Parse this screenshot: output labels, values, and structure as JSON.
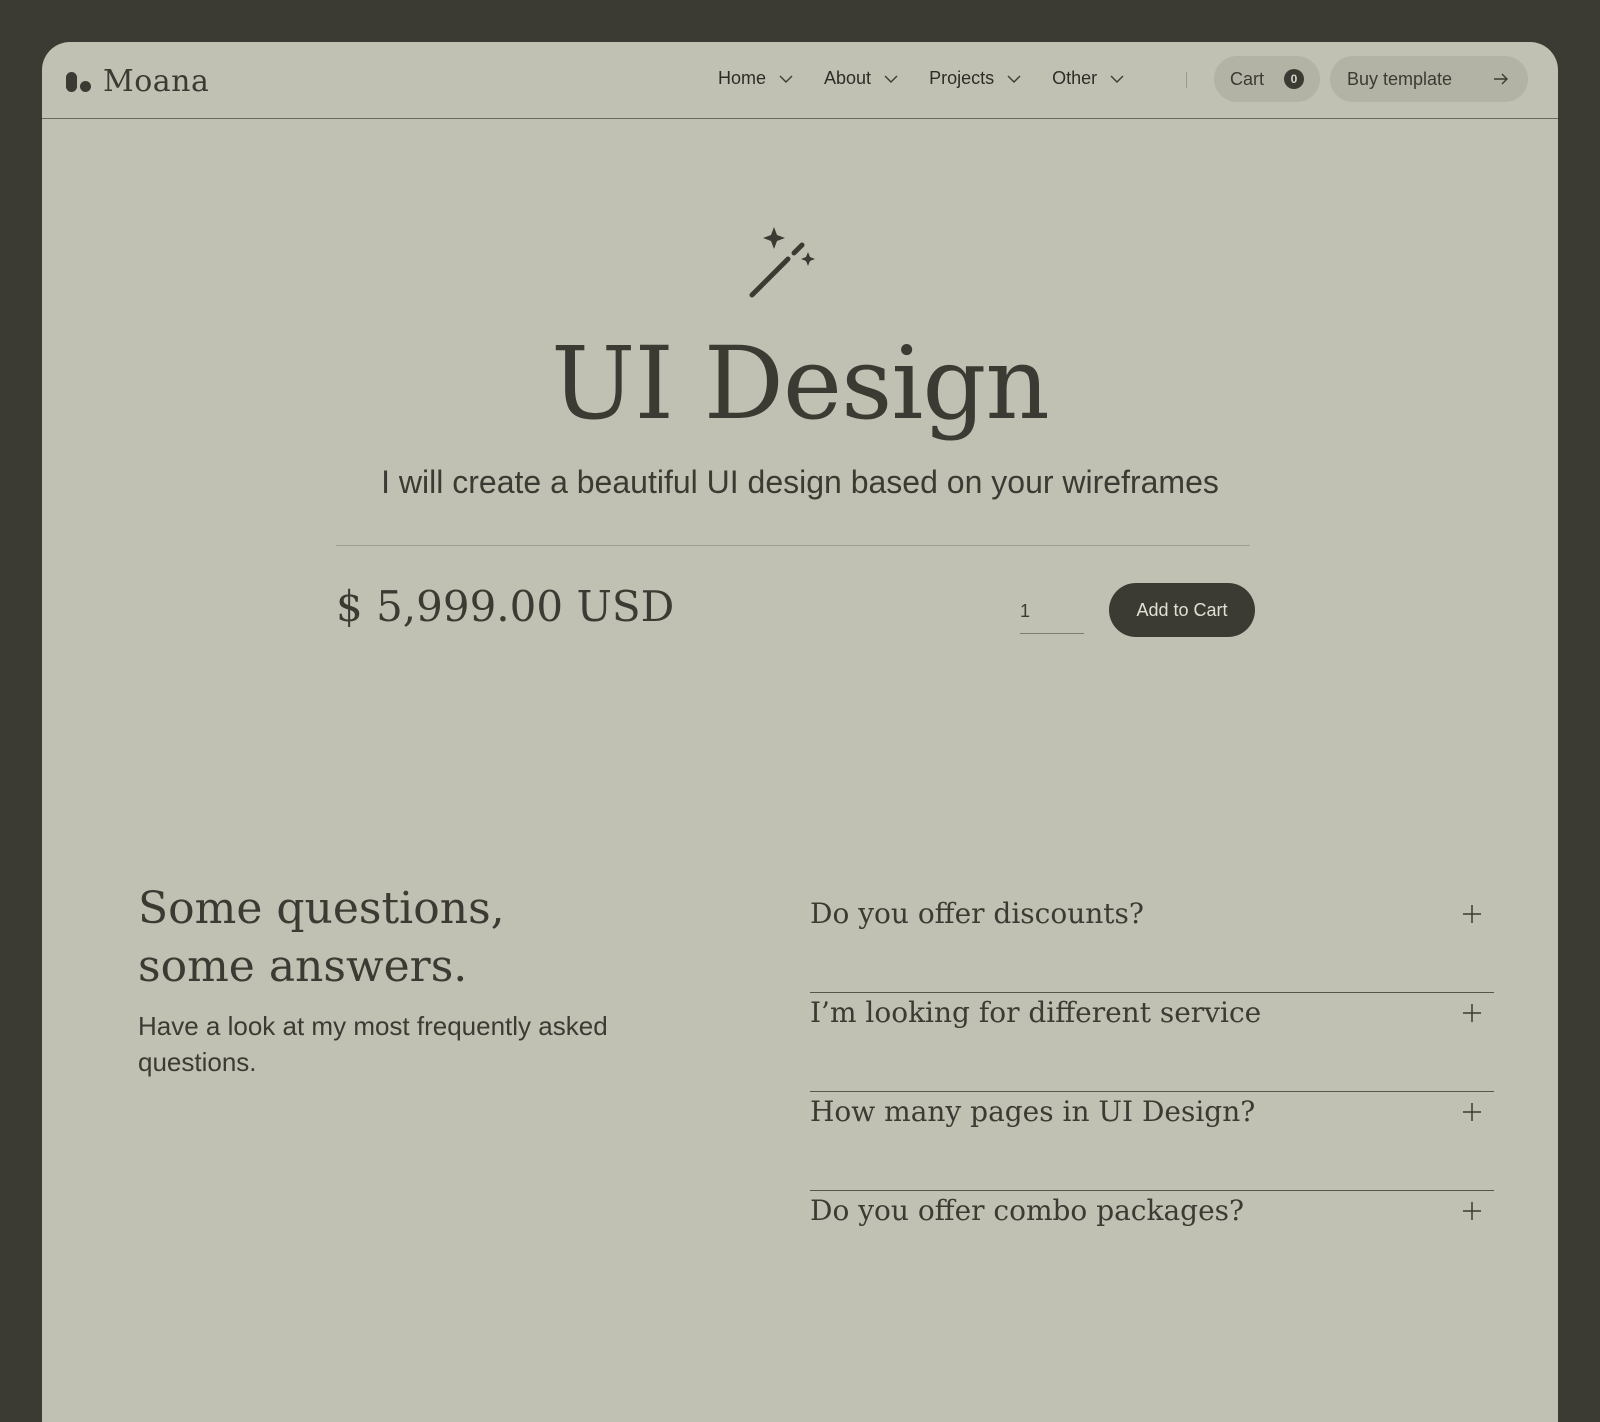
{
  "brand": {
    "name": "Moana"
  },
  "nav": {
    "items": [
      {
        "label": "Home",
        "icon": "chevron-down-icon"
      },
      {
        "label": "About",
        "icon": "chevron-down-icon"
      },
      {
        "label": "Projects",
        "icon": "chevron-down-icon"
      },
      {
        "label": "Other",
        "icon": "chevron-down-icon"
      }
    ],
    "cart": {
      "label": "Cart",
      "count": "0"
    },
    "buy": {
      "label": "Buy template",
      "icon": "arrow-right-icon"
    }
  },
  "hero": {
    "icon": "magic-wand-icon",
    "title": "UI Design",
    "subtitle": "I will create a beautiful UI design based on your wireframes"
  },
  "product": {
    "price": "$ 5,999.00 USD",
    "quantity": "1",
    "add_to_cart_label": "Add to Cart"
  },
  "faq": {
    "heading_line1": "Some questions,",
    "heading_line2": "some answers.",
    "description": "Have a look at my most frequently asked questions.",
    "items": [
      {
        "question": "Do you offer discounts?",
        "icon": "plus-icon"
      },
      {
        "question": "I’m looking for different service",
        "icon": "plus-icon"
      },
      {
        "question": "How many pages in UI Design?",
        "icon": "plus-icon"
      },
      {
        "question": "Do you offer combo packages?",
        "icon": "plus-icon"
      }
    ]
  },
  "colors": {
    "background": "#3b3b33",
    "surface": "#c1c1b3",
    "button_surface": "#b3b3a5",
    "text": "#3b3b33"
  }
}
